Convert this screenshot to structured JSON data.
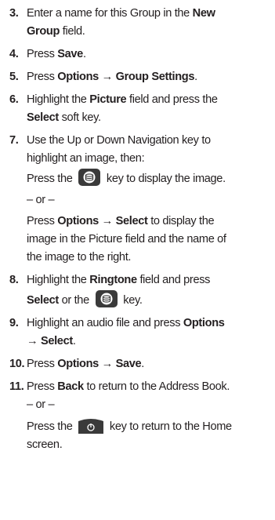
{
  "steps": [
    {
      "number": "3.",
      "lines": [
        [
          "Enter a name for this Group in the ",
          "New"
        ],
        [
          "Group",
          " field."
        ]
      ]
    },
    {
      "number": "4.",
      "before": "Press ",
      "bold": "Save",
      "after": "."
    },
    {
      "number": "5.",
      "before": "Press ",
      "bold": "Options → Group Settings",
      "after": "."
    },
    {
      "number": "6.",
      "line1": [
        "Highlight the ",
        "Picture",
        " field and press the"
      ],
      "line2": [
        "Select",
        " soft key."
      ]
    },
    {
      "number": "7.",
      "line1": "Use the Up or Down Navigation key to",
      "line2": "highlight an image, then:",
      "line3_before": "Press the ",
      "line3_after": " key to display the image.",
      "or": "– or –",
      "line5": [
        "Press ",
        "Options → Select",
        " to display the"
      ],
      "line6": "image in the Picture field and the name of",
      "line7": "the image to the right."
    },
    {
      "number": "8.",
      "line1": [
        "Highlight the ",
        "Ringtone",
        " field and press"
      ],
      "line2": [
        "Select",
        " or the ",
        " key."
      ]
    },
    {
      "number": "9.",
      "line1": [
        "Highlight an audio file and press ",
        "Options"
      ],
      "line2": [
        "→ Select",
        "."
      ]
    },
    {
      "number": "10.",
      "before": "Press ",
      "bold": "Options → Save",
      "after": "."
    },
    {
      "number": "11.",
      "line1": [
        "Press ",
        "Back",
        " to return to the Address Book."
      ],
      "or": "– or –",
      "line3_before": "Press the ",
      "line3_after": " key to return to the Home",
      "line4": "screen."
    }
  ],
  "icons": {
    "select_key": "ok-select-key-icon",
    "end_key": "end-power-key-icon"
  },
  "colors": {
    "text": "#231f20",
    "key_dark": "#3a3a3a"
  }
}
